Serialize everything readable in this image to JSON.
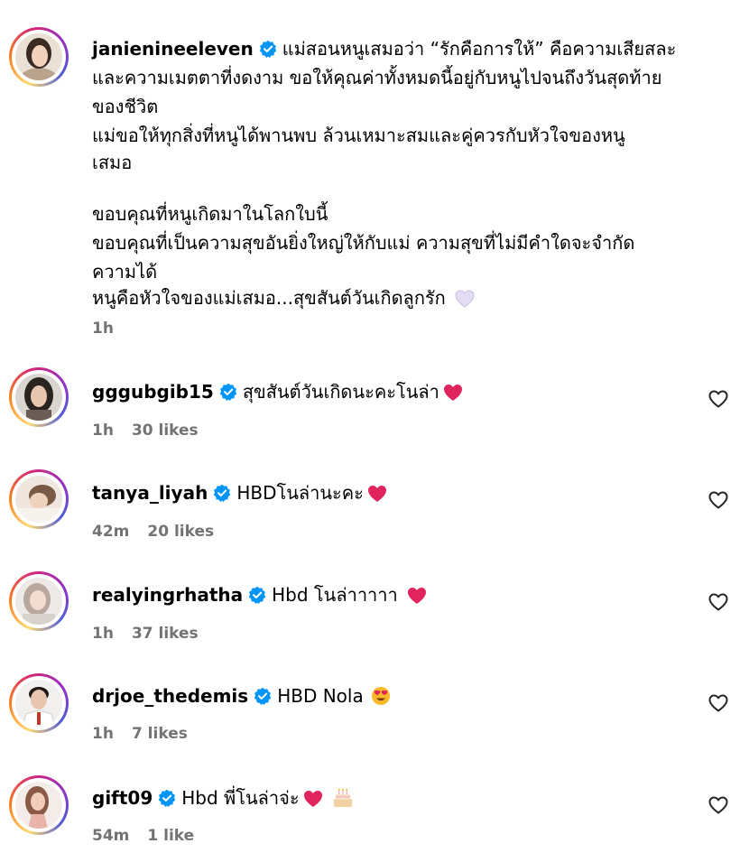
{
  "post": {
    "username": "janienineeleven",
    "caption_lines": [
      "แม่สอนหนูเสมอว่า “รักคือการให้” คือความเสียสละ",
      "และความเมตตาที่งดงาม ขอให้คุณค่าทั้งหมดนี้อยู่กับหนูไปจนถึงวันสุดท้าย",
      "ของชีวิต",
      "แม่ขอให้ทุกสิ่งที่หนูได้พานพบ ล้วนเหมาะสมและคู่ควรกับหัวใจของหนู",
      "เสมอ",
      "ขอบคุณที่หนูเกิดมาในโลกใบนี้",
      "ขอบคุณที่เป็นความสุขอันยิ่งใหญ่ให้กับแม่ ความสุขที่ไม่มีคำใดจะจำกัด",
      "ความได้",
      "หนูคือหัวใจของแม่เสมอ...สุขสันต์วันเกิดลูกรัก"
    ],
    "end_emoji": "white-heart-icon",
    "time": "1h"
  },
  "comments": [
    {
      "username": "gggubgib15",
      "text": "สุขสันต์วันเกิดนะคะโนล่า",
      "emoji": "red-heart-icon",
      "time": "1h",
      "likes": "30 likes"
    },
    {
      "username": "tanya_liyah",
      "text": "HBDโนล่านะคะ",
      "emoji": "red-heart-icon",
      "time": "42m",
      "likes": "20 likes"
    },
    {
      "username": "realyingrhatha",
      "text": "Hbd โนล่าาาาา ",
      "emoji": "red-heart-icon",
      "time": "1h",
      "likes": "37 likes"
    },
    {
      "username": "drjoe_thedemis",
      "text": "HBD Nola",
      "emoji": "heart-eyes-icon",
      "time": "1h",
      "likes": "7 likes"
    },
    {
      "username": "gift09",
      "text": "Hbd พี่โนล่าจ่ะ",
      "emoji": "red-heart-and-cake-icon",
      "time": "54m",
      "likes": "1 like"
    }
  ],
  "colors": {
    "verified_blue": "#0095f6",
    "meta_gray": "#737373",
    "heart_red": "#e0245e"
  }
}
